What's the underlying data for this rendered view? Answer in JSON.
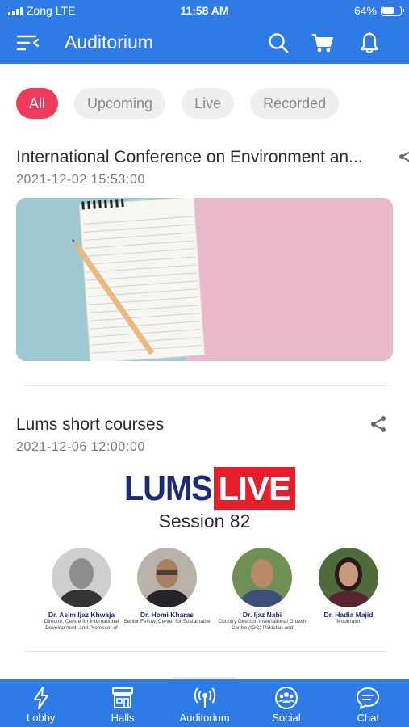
{
  "status_bar": {
    "carrier": "Zong  LTE",
    "time": "11:58 AM",
    "battery": "64%"
  },
  "header": {
    "title": "Auditorium",
    "icons": [
      "menu-back-icon",
      "search-icon",
      "cart-icon",
      "bell-icon"
    ]
  },
  "filters": {
    "items": [
      {
        "label": "All",
        "active": true
      },
      {
        "label": "Upcoming",
        "active": false
      },
      {
        "label": "Live",
        "active": false
      },
      {
        "label": "Recorded",
        "active": false
      }
    ]
  },
  "events": [
    {
      "title": "International Conference on Environment an...",
      "date": "2021-12-02 15:53:00"
    },
    {
      "title": "Lums short courses",
      "date": "2021-12-06 12:00:00",
      "poster": {
        "brand": "LUMS",
        "brand_accent": "LIVE",
        "session": "Session 82",
        "speakers": [
          {
            "name": "Dr. Asim Ijaz Khwaja",
            "role": "Director, Centre for International Development, and Professor of"
          },
          {
            "name": "Dr. Homi Kharas",
            "role": "Senior Fellow, Center for Sustainable"
          },
          {
            "name": "Dr. Ijaz Nabi",
            "role": "Country Director, International Growth Centre (IGC) Pakistan and"
          },
          {
            "name": "Dr. Hadia Majid",
            "role": "Moderator"
          }
        ]
      }
    }
  ],
  "bottom_nav": {
    "items": [
      {
        "label": "Lobby",
        "icon": "lightning-icon"
      },
      {
        "label": "Halls",
        "icon": "storefront-icon"
      },
      {
        "label": "Auditorium",
        "icon": "broadcast-icon"
      },
      {
        "label": "Social",
        "icon": "people-icon"
      },
      {
        "label": "Chat",
        "icon": "chat-bubble-icon"
      }
    ]
  },
  "colors": {
    "primary": "#2f7be5",
    "chip_active": "#ef3a5d",
    "lums_blue": "#1c2a78",
    "live_red": "#e51e2b"
  }
}
